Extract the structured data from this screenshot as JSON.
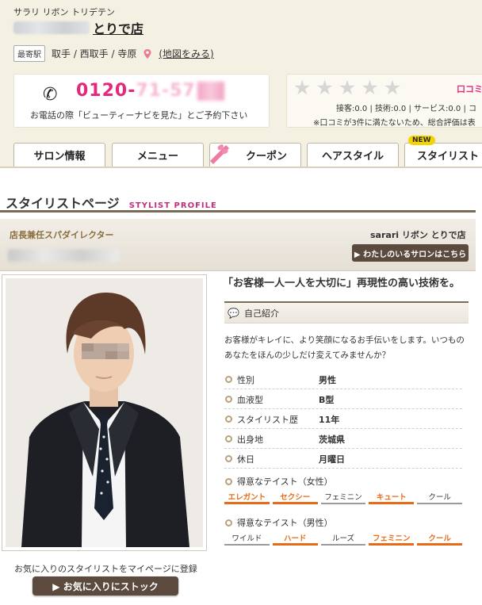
{
  "header": {
    "salon_kana": "サラリ リボン トリデテン",
    "salon_name_suffix": "とりで店",
    "station_tag": "最寄駅",
    "stations": "取手 / 西取手 / 寺原",
    "map_link": "(地図をみる)"
  },
  "phone": {
    "number_prefix": "0120-",
    "number_middle": "71-57",
    "note": "お電話の際「ビューティーナビを見た」とご予約下さい"
  },
  "rating": {
    "stars_filled": 0,
    "stars_total": 5,
    "kuchikomi_label": "口コミ",
    "scores": "接客:0.0 | 技術:0.0 | サービス:0.0 | コ",
    "note": "※口コミが3件に満たないため、総合評価は表"
  },
  "tabs": [
    {
      "label": "サロン情報"
    },
    {
      "label": "メニュー"
    },
    {
      "label": "クーポン"
    },
    {
      "label": "ヘアスタイル"
    },
    {
      "label": "スタイリスト",
      "badge": "NEW"
    }
  ],
  "page": {
    "title_jp": "スタイリストページ",
    "title_en": "STYLIST PROFILE"
  },
  "profile": {
    "role": "店長兼任スパダイレクター",
    "salon": "sarari リボン とりで店",
    "salon_button": "▶ わたしのいるサロンはこちら",
    "catch_copy": "「お客様一人一人を大切に」再現性の高い技術を。",
    "intro_heading": "自己紹介",
    "intro_text": "お客様がキレイに、より笑顔になるお手伝いをします。いつものあなたをほんの少しだけ変えてみませんか？",
    "favorite_label": "お気に入りのスタイリストをマイページに登録",
    "favorite_button": "▶ お気に入りにストック"
  },
  "attributes": [
    {
      "key": "性別",
      "value": "男性"
    },
    {
      "key": "血液型",
      "value": "B型"
    },
    {
      "key": "スタイリスト歴",
      "value": "11年"
    },
    {
      "key": "出身地",
      "value": "茨城県"
    },
    {
      "key": "休日",
      "value": "月曜日"
    }
  ],
  "taste_female": {
    "title": "得意なテイスト（女性）",
    "items": [
      {
        "label": "エレガント",
        "on": true
      },
      {
        "label": "セクシー",
        "on": true
      },
      {
        "label": "フェミニン",
        "on": false
      },
      {
        "label": "キュート",
        "on": true
      },
      {
        "label": "クール",
        "on": false
      }
    ]
  },
  "taste_male": {
    "title": "得意なテイスト（男性）",
    "items": [
      {
        "label": "ワイルド",
        "on": false
      },
      {
        "label": "ハード",
        "on": true
      },
      {
        "label": "ルーズ",
        "on": false
      },
      {
        "label": "フェミニン",
        "on": true
      },
      {
        "label": "クール",
        "on": true
      }
    ]
  },
  "colors": {
    "header_bg": "#f4f0e2",
    "phone_pink": "#e5287d",
    "brand_brown": "#5b4a3d",
    "accent_orange": "#e86a16"
  }
}
